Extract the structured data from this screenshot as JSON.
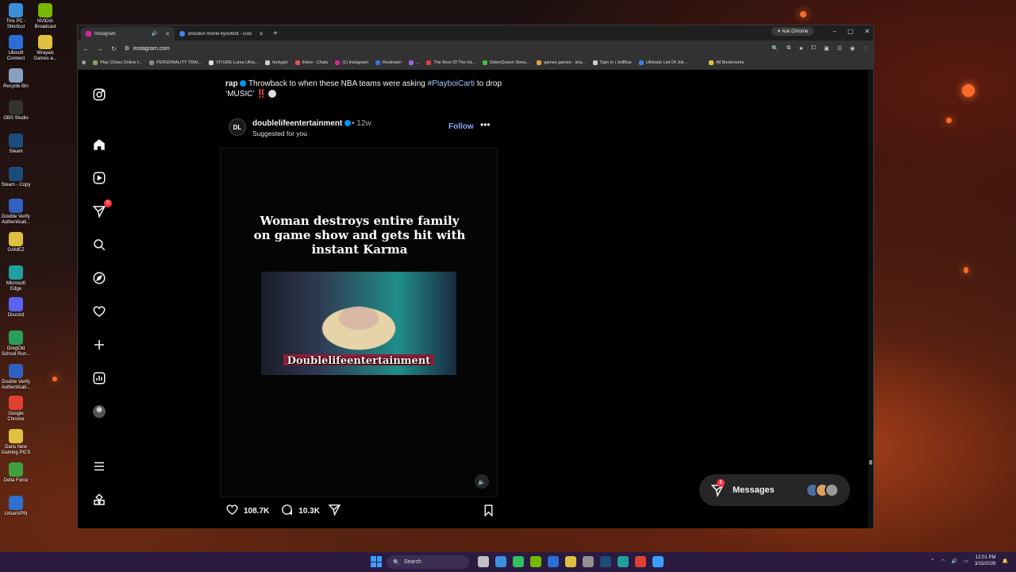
{
  "desktop": {
    "icons": [
      {
        "label": "This PC - Shortcut",
        "color": "#3b8fd8"
      },
      {
        "label": "NVIDIA Broadcast",
        "color": "#76b900"
      },
      {
        "label": "Ubisoft Connect",
        "color": "#2a6fd8"
      },
      {
        "label": "Wrayals Games a...",
        "color": "#e0c040"
      },
      {
        "label": "Recycle Bin",
        "color": "#8aa0c0"
      },
      {
        "label": "OBS Studio",
        "color": "#333333"
      },
      {
        "label": "Steam",
        "color": "#1b4c7a"
      },
      {
        "label": "Steam - Copy",
        "color": "#1b4c7a"
      },
      {
        "label": "Double Verify Authenticati...",
        "color": "#3060c0"
      },
      {
        "label": "GAMEZ",
        "color": "#e0c040"
      },
      {
        "label": "Microsoft Edge",
        "color": "#1fa0a0"
      },
      {
        "label": "Discord",
        "color": "#5865f2"
      },
      {
        "label": "GregOld School Run...",
        "color": "#2a9f5a"
      },
      {
        "label": "Double Verify Authenticati...",
        "color": "#3060c0"
      },
      {
        "label": "Google Chrome",
        "color": "#e04030"
      },
      {
        "label": "Dans New Gaming PICS",
        "color": "#e0c040"
      },
      {
        "label": "Delta Force",
        "color": "#40a040"
      },
      {
        "label": "UrbanVPN",
        "color": "#3070d0"
      }
    ]
  },
  "browser": {
    "tabs": [
      {
        "title": "Instagram",
        "active": true,
        "fav_color": "#d6249f"
      },
      {
        "title": "dresdun movie kyootbot - Goo",
        "active": false,
        "fav_color": "#4285f4"
      }
    ],
    "new_tab": "+",
    "ask_chrome": "Ask Chrome",
    "window_controls": {
      "minimize": "–",
      "maximize": "▢",
      "close": "✕"
    },
    "url": "instagram.com",
    "bookmarks": [
      {
        "label": "Play Chess Online f...",
        "color": "#7fa650"
      },
      {
        "label": "PERSONALITY TRAI...",
        "color": "#888888"
      },
      {
        "label": "VITURE Luma Ultra...",
        "color": "#dddddd"
      },
      {
        "label": "fentygirl",
        "color": "#cccccc"
      },
      {
        "label": "Inbox - Chats",
        "color": "#e05050"
      },
      {
        "label": "(1) Instagram",
        "color": "#d6249f"
      },
      {
        "label": "Restream",
        "color": "#3a6fe0"
      },
      {
        "label": "...",
        "color": "#a060e0"
      },
      {
        "label": "The Best Of The Int...",
        "color": "#e04040"
      },
      {
        "label": "DelenQueen Strea...",
        "color": "#40c040"
      },
      {
        "label": "games games - sha...",
        "color": "#e0a040"
      },
      {
        "label": "Sign In | JetBlue",
        "color": "#cccccc"
      },
      {
        "label": "Ultimate List Of Jok...",
        "color": "#4080e0"
      },
      {
        "label": "All Bookmarks",
        "color": "#e0c040"
      }
    ]
  },
  "instagram": {
    "nav": {
      "home": "home-icon",
      "reels": "reels-icon",
      "messages_badge": "5",
      "search": "search-icon",
      "explore": "explore-icon",
      "notifications": "heart-icon",
      "create": "plus-icon",
      "dashboard": "dashboard-icon"
    },
    "caption": {
      "user": "rap",
      "text": " Throwback to when these NBA teams were asking ",
      "hashtag": "#PlayboiCarti",
      "text2": " to drop ‘MUSIC’ ‼️"
    },
    "post": {
      "avatar_text": "DL",
      "username": "doublelifeentertainment",
      "time": "• 12w",
      "subtitle": "Suggested for you",
      "follow": "Follow",
      "more": "•••",
      "headline": "Woman destroys entire family on game show and gets hit with instant Karma",
      "watermark": "Doublelifeentertainment",
      "mute": "🔈",
      "likes": "108.7K",
      "comments": "10.3K"
    },
    "messages": {
      "label": "Messages",
      "badge": "3"
    }
  },
  "taskbar": {
    "search_placeholder": "Search",
    "apps": [
      "#c0c0c0",
      "#3a8fe0",
      "#30c060",
      "#76b900",
      "#2a6fd8",
      "#e0c040",
      "#909090",
      "#1b4c7a",
      "#1fa0a0",
      "#e04030",
      "#3aa0ff"
    ],
    "time": "12:01 PM",
    "date": "3/15/2026"
  }
}
